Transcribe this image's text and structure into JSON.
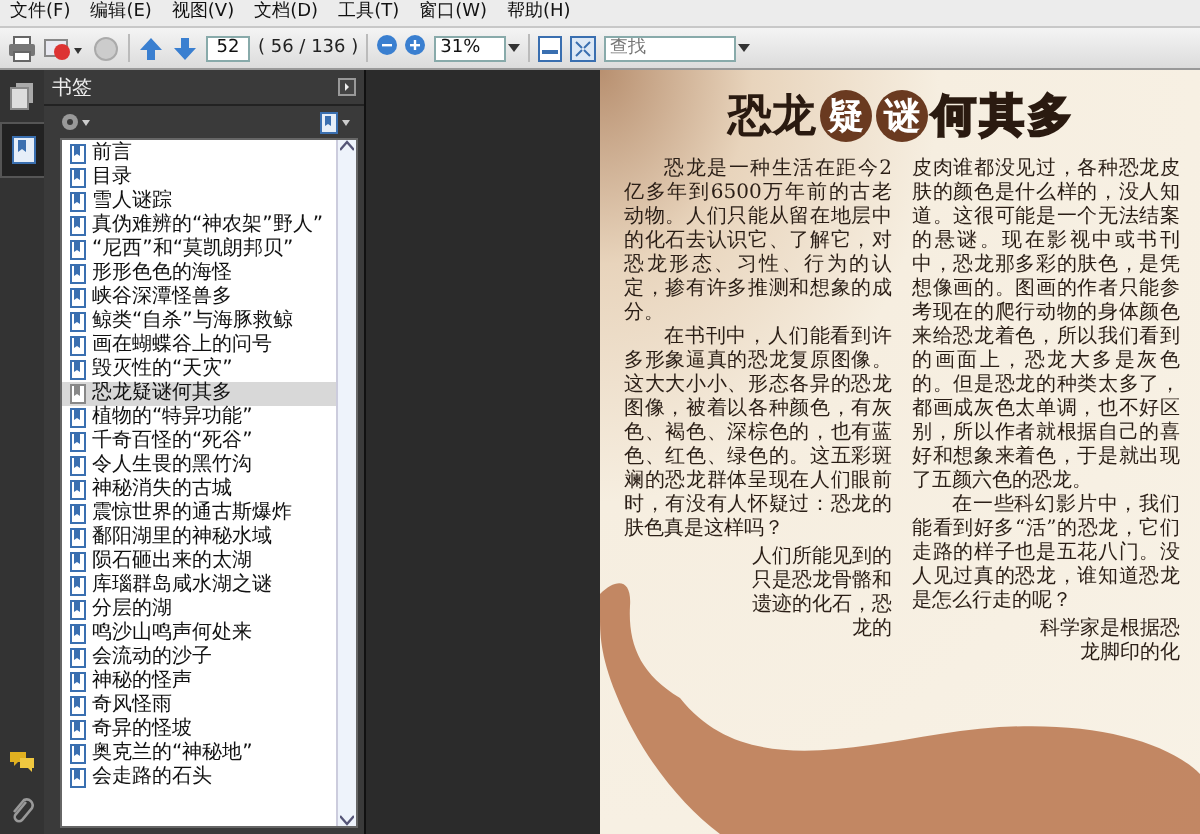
{
  "menu": [
    "文件(F)",
    "编辑(E)",
    "视图(V)",
    "文档(D)",
    "工具(T)",
    "窗口(W)",
    "帮助(H)"
  ],
  "toolbar": {
    "page_field": "52",
    "page_count": "( 56 / 136 )",
    "zoom_field": "31%",
    "search": {
      "placeholder": "查找"
    }
  },
  "side_tabs": [
    {
      "kind": "pages",
      "selected": false
    },
    {
      "kind": "bookmarks",
      "selected": true
    }
  ],
  "bookmarks": {
    "title": "书签",
    "items": [
      {
        "label": "前言",
        "selected": false
      },
      {
        "label": "目录",
        "selected": false
      },
      {
        "label": "雪人谜踪",
        "selected": false
      },
      {
        "label": "真伪难辨的“神农架”野人”",
        "selected": false
      },
      {
        "label": "“尼西”和“莫凯朗邦贝”",
        "selected": false
      },
      {
        "label": "形形色色的海怪",
        "selected": false
      },
      {
        "label": "峡谷深潭怪兽多",
        "selected": false
      },
      {
        "label": "鲸类“自杀”与海豚救鲸",
        "selected": false
      },
      {
        "label": "画在蝴蝶谷上的问号",
        "selected": false
      },
      {
        "label": "毁灭性的“天灾”",
        "selected": false
      },
      {
        "label": "恐龙疑谜何其多",
        "selected": true
      },
      {
        "label": "植物的“特异功能”",
        "selected": false
      },
      {
        "label": "千奇百怪的“死谷”",
        "selected": false
      },
      {
        "label": "令人生畏的黑竹沟",
        "selected": false
      },
      {
        "label": "神秘消失的古城",
        "selected": false
      },
      {
        "label": "震惊世界的通古斯爆炸",
        "selected": false
      },
      {
        "label": "鄱阳湖里的神秘水域",
        "selected": false
      },
      {
        "label": "陨石砸出来的太湖",
        "selected": false
      },
      {
        "label": "库瑙群岛咸水湖之谜",
        "selected": false
      },
      {
        "label": "分层的湖",
        "selected": false
      },
      {
        "label": "鸣沙山鸣声何处来",
        "selected": false
      },
      {
        "label": "会流动的沙子",
        "selected": false
      },
      {
        "label": "神秘的怪声",
        "selected": false
      },
      {
        "label": "奇风怪雨",
        "selected": false
      },
      {
        "label": "奇异的怪坡",
        "selected": false
      },
      {
        "label": "奥克兰的“神秘地”",
        "selected": false
      },
      {
        "label": "会走路的石头",
        "selected": false
      }
    ]
  },
  "page": {
    "title": [
      {
        "text": "恐龙",
        "kind": "plain"
      },
      {
        "text": "疑",
        "kind": "circled"
      },
      {
        "text": "谜",
        "kind": "circled"
      },
      {
        "text": "何其多",
        "kind": "outlined"
      }
    ],
    "columns": [
      {
        "paragraphs": [
          {
            "kind": "indent",
            "text": "恐龙是一种生活在距今2亿多年到6500万年前的古老动物。人们只能从留在地层中的化石去认识它、了解它，对恐龙形态、习性、行为的认定，掺有许多推测和想象的成分。"
          },
          {
            "kind": "indent",
            "text": "在书刊中，人们能看到许多形象逼真的恐龙复原图像。这大大小小、形态各异的恐龙图像，被着以各种颜色，有灰色、褐色、深棕色的，也有蓝色、红色、绿色的。这五彩斑斓的恐龙群体呈现在人们眼前时，有没有人怀疑过：恐龙的肤色真是这样吗？"
          },
          {
            "kind": "narrow",
            "text": "人们所能见到的只是恐龙骨骼和遗迹的化石，恐龙的"
          }
        ]
      },
      {
        "paragraphs": [
          {
            "kind": "flush",
            "text": "皮肉谁都没见过，各种恐龙皮肤的颜色是什么样的，没人知道。这很可能是一个无法结案的悬谜。现在影视中或书刊中，恐龙那多彩的肤色，是凭想像画的。图画的作者只能参考现在的爬行动物的身体颜色来给恐龙着色，所以我们看到的画面上，恐龙大多是灰色的。但是恐龙的种类太多了，都画成灰色太单调，也不好区别，所以作者就根据自己的喜好和想象来着色，于是就出现了五颜六色的恐龙。"
          },
          {
            "kind": "indent",
            "text": "在一些科幻影片中，我们能看到好多“活”的恐龙，它们走路的样子也是五花八门。没人见过真的恐龙，谁知道恐龙是怎么行走的呢？"
          },
          {
            "kind": "narrow",
            "text": "科学家是根据恐龙脚印的化"
          }
        ]
      }
    ]
  }
}
